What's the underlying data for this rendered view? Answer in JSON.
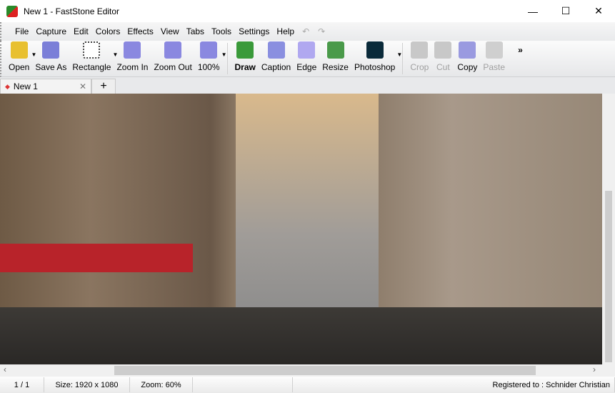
{
  "window": {
    "title": "New 1 - FastStone Editor",
    "minimize": "—",
    "maximize": "☐",
    "close": "✕"
  },
  "menu": [
    "File",
    "Capture",
    "Edit",
    "Colors",
    "Effects",
    "View",
    "Tabs",
    "Tools",
    "Settings",
    "Help"
  ],
  "undo": "↶",
  "redo": "↷",
  "toolbar": [
    {
      "label": "Open",
      "icon": "open-folder-icon",
      "color": "#e8c030",
      "dropdown": true
    },
    {
      "label": "Save As",
      "icon": "floppy-disk-icon",
      "color": "#7b7fd8"
    },
    {
      "label": "Rectangle",
      "icon": "rectangle-select-icon",
      "color": "#ffffff",
      "dropdown": true
    },
    {
      "label": "Zoom In",
      "icon": "zoom-in-icon",
      "color": "#8a88e0"
    },
    {
      "label": "Zoom Out",
      "icon": "zoom-out-icon",
      "color": "#8a88e0"
    },
    {
      "label": "100%",
      "icon": "zoom-actual-icon",
      "color": "#8a88e0",
      "dropdown": true
    },
    {
      "label": "Draw",
      "icon": "draw-icon",
      "color": "#3a9a3a",
      "bold": true,
      "sep_before": true
    },
    {
      "label": "Caption",
      "icon": "caption-icon",
      "color": "#8a8fe0"
    },
    {
      "label": "Edge",
      "icon": "edge-icon",
      "color": "#b0a8f0"
    },
    {
      "label": "Resize",
      "icon": "resize-icon",
      "color": "#4a9a4a"
    },
    {
      "label": "Photoshop",
      "icon": "photoshop-icon",
      "color": "#0a2a3a",
      "dropdown": true
    },
    {
      "label": "Crop",
      "icon": "crop-icon",
      "color": "#c8c8c8",
      "disabled": true,
      "sep_before": true
    },
    {
      "label": "Cut",
      "icon": "scissors-icon",
      "color": "#c8c8c8",
      "disabled": true
    },
    {
      "label": "Copy",
      "icon": "copy-icon",
      "color": "#9a9ae0"
    },
    {
      "label": "Paste",
      "icon": "paste-icon",
      "color": "#cfcfcf",
      "disabled": true
    }
  ],
  "overflow": "»",
  "tabs": [
    {
      "label": "New 1",
      "close": "✕"
    }
  ],
  "add_tab": "+",
  "status": {
    "page": "1 / 1",
    "size": "Size: 1920 x 1080",
    "zoom": "Zoom: 60%",
    "registered": "Registered to : Schnider Christian"
  }
}
